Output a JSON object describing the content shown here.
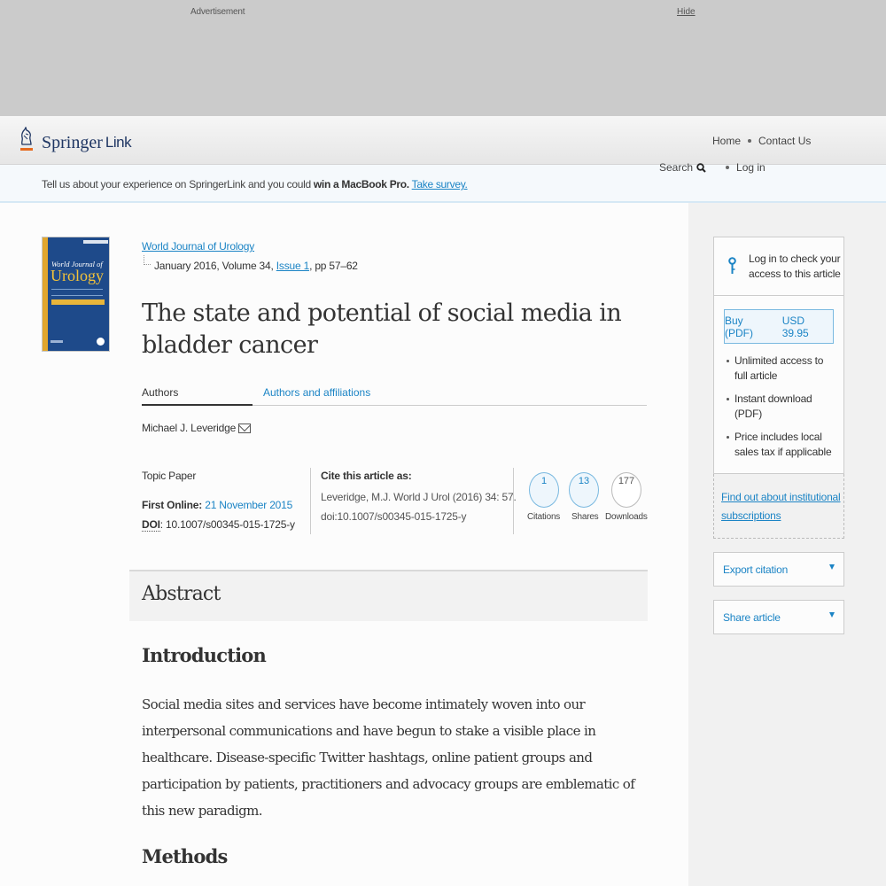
{
  "ad": {
    "label": "Advertisement",
    "hide": "Hide"
  },
  "header": {
    "logo_primary": "Springer",
    "logo_secondary": "Link",
    "nav": {
      "home": "Home",
      "contact": "Contact Us",
      "search": "Search",
      "login": "Log in"
    }
  },
  "survey": {
    "text": "Tell us about your experience on SpringerLink and you could ",
    "bold": "win a MacBook Pro.",
    "link": "Take survey."
  },
  "cover": {
    "line1": "World Journal of",
    "line2": "Urology"
  },
  "article": {
    "journal": "World Journal of Urology",
    "issue_prefix": "January 2016, Volume 34, ",
    "issue_link": "Issue 1",
    "issue_suffix": ", pp 57–62",
    "title": "The state and potential of social media in bladder cancer",
    "tabs": {
      "authors": "Authors",
      "affiliations": "Authors and affiliations"
    },
    "author": "Michael J. Leveridge",
    "type": "Topic Paper",
    "first_online_label": "First Online: ",
    "first_online": "21 November 2015",
    "doi_label": "DOI",
    "doi": ": 10.1007/s00345-015-1725-y",
    "cite_heading": "Cite this article as:",
    "cite_line1": "Leveridge, M.J. World J Urol (2016) 34: 57.",
    "cite_line2": "doi:10.1007/s00345-015-1725-y",
    "metrics": [
      {
        "value": "1",
        "label": "Citations"
      },
      {
        "value": "13",
        "label": "Shares"
      },
      {
        "value": "177",
        "label": "Downloads"
      }
    ]
  },
  "abstract": {
    "heading": "Abstract",
    "intro_heading": "Introduction",
    "intro_text": "Social media sites and services have become intimately woven into our interpersonal communications and have begun to stake a visible place in healthcare. Disease-specific Twitter hashtags, online patient groups and participation by patients, practitioners and advocacy groups are emblematic of this new paradigm.",
    "methods_heading": "Methods"
  },
  "sidebar": {
    "login_text": "Log in to check your access to this article",
    "buy_label": "Buy (PDF)",
    "price": "USD 39.95",
    "benefits": [
      "Unlimited access to full article",
      "Instant download (PDF)",
      "Price includes local sales tax if applicable"
    ],
    "institutional_link": "Find out about institutional subscriptions",
    "export_citation": "Export citation",
    "share_article": "Share article"
  },
  "colors": {
    "link": "#1b84c5",
    "brand_navy": "#1f3663",
    "brand_orange": "#e66b20"
  }
}
